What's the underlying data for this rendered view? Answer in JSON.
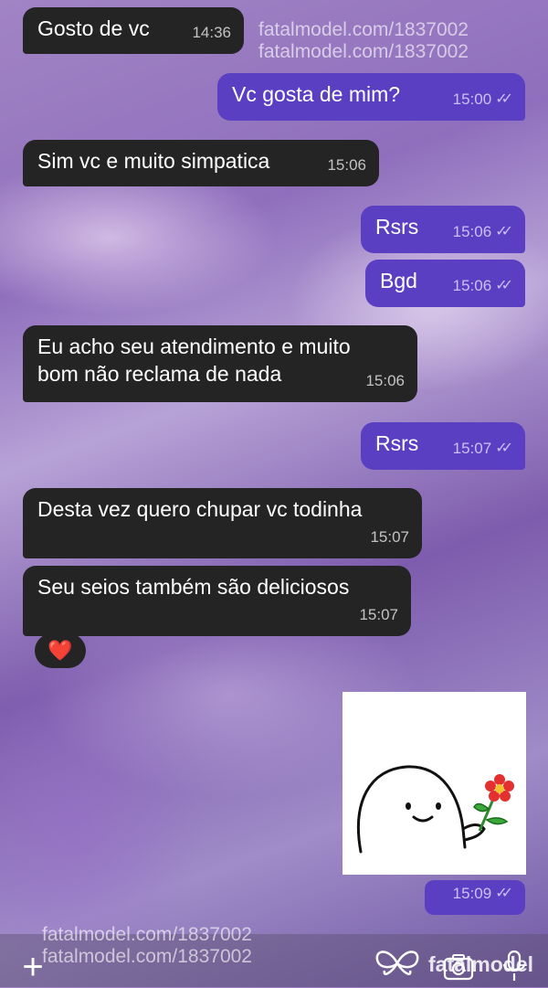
{
  "messages": [
    {
      "id": "m1",
      "dir": "in",
      "text": "Gosto de vc",
      "time": "14:36"
    },
    {
      "id": "m2",
      "dir": "out",
      "text": "Vc gosta de mim?",
      "time": "15:00",
      "read": true
    },
    {
      "id": "m3",
      "dir": "in",
      "text": "Sim vc e muito simpatica",
      "time": "15:06"
    },
    {
      "id": "m4",
      "dir": "out",
      "text": "Rsrs",
      "time": "15:06",
      "read": true
    },
    {
      "id": "m5",
      "dir": "out",
      "text": "Bgd",
      "time": "15:06",
      "read": true
    },
    {
      "id": "m6",
      "dir": "in",
      "text": "Eu acho seu atendimento  e muito\nbom não  reclama de nada",
      "time": "15:06"
    },
    {
      "id": "m7",
      "dir": "out",
      "text": "Rsrs",
      "time": "15:07",
      "read": true
    },
    {
      "id": "m8",
      "dir": "in",
      "text": "Desta vez quero chupar vc todinha",
      "time": "15:07"
    },
    {
      "id": "m9",
      "dir": "in",
      "text": "Seu seios também  são deliciosos",
      "time": "15:07"
    },
    {
      "id": "m10",
      "dir": "out",
      "sticker": true,
      "time": "15:09",
      "read": true
    }
  ],
  "reaction": {
    "emoji": "❤️"
  },
  "watermark": {
    "text": "fatalmodel.com/1837002",
    "brand_text": "fatalmodel"
  },
  "composer": {
    "add_label": "+"
  },
  "icons": {
    "checks": "double-check-icon",
    "add": "plus-icon",
    "camera": "camera-icon",
    "mic": "microphone-icon",
    "brand": "butterfly-logo"
  },
  "colors": {
    "incoming_bubble": "#242424",
    "outgoing_bubble": "#5a3fc3",
    "reaction_heart": "#ff2d3c"
  }
}
